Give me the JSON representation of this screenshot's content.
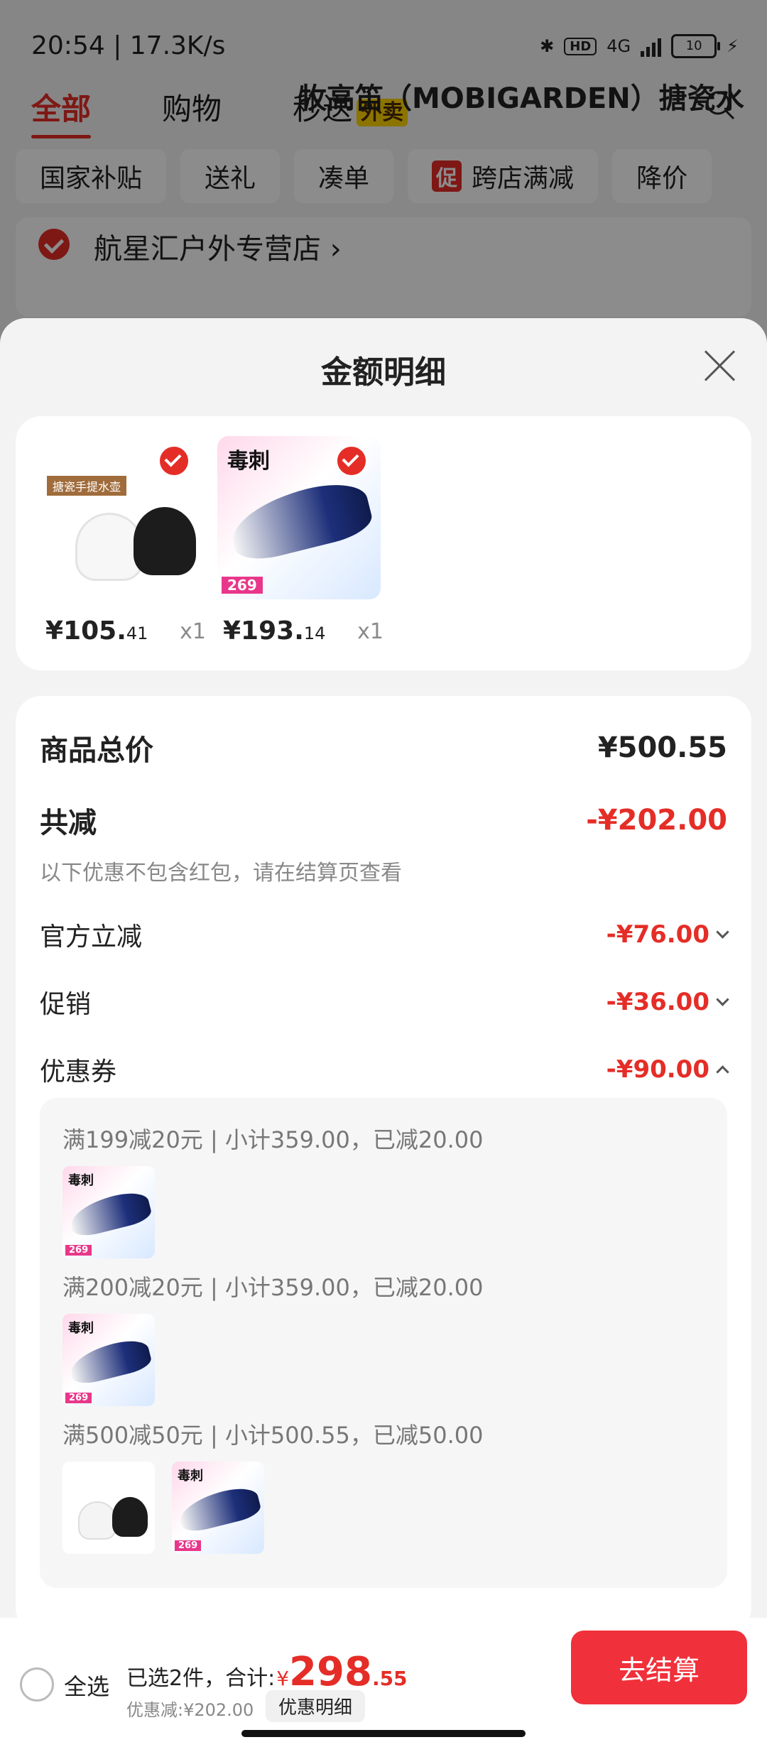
{
  "status_bar": {
    "time": "20:54 | 17.3K/s",
    "network": "4G",
    "battery": "10"
  },
  "top_tabs": {
    "all": "全部",
    "shopping": "购物",
    "second_delivery": "秒送",
    "takeout_badge": "外卖"
  },
  "filters": [
    "国家补贴",
    "送礼",
    "凑单",
    "跨店满减",
    "降价"
  ],
  "promo_mark": "促",
  "store": {
    "name": "航星汇户外专营店",
    "product_peek": "牧高笛（MOBIGARDEN）搪瓷水"
  },
  "sheet": {
    "title": "金额明细",
    "items": [
      {
        "price_int": "¥105.",
        "price_dec": "41",
        "qty": "x1",
        "tag": "搪瓷手提水壶"
      },
      {
        "price_int": "¥193.",
        "price_dec": "14",
        "qty": "x1",
        "brand": "毒刺",
        "badge_price": "269"
      }
    ],
    "summary": {
      "total_label": "商品总价",
      "total_value": "¥500.55",
      "reduce_label": "共减",
      "reduce_value": "-¥202.00",
      "note": "以下优惠不包含红包，请在结算页查看",
      "official_label": "官方立减",
      "official_value": "-¥76.00",
      "promo_label": "促销",
      "promo_value": "-¥36.00",
      "coupon_label": "优惠券",
      "coupon_value": "-¥90.00"
    },
    "coupons": [
      "满199减20元 | 小计359.00，已减20.00",
      "满200减20元 | 小计359.00，已减20.00",
      "满500减50元 | 小计500.55，已减50.00"
    ]
  },
  "bottom_bar": {
    "select_all": "全选",
    "selected_text": "已选2件，合计:",
    "currency": "¥",
    "total_int": "298",
    "total_dec": ".55",
    "discount_text": "优惠减:¥202.00",
    "detail_button": "优惠明细",
    "checkout": "去结算"
  }
}
